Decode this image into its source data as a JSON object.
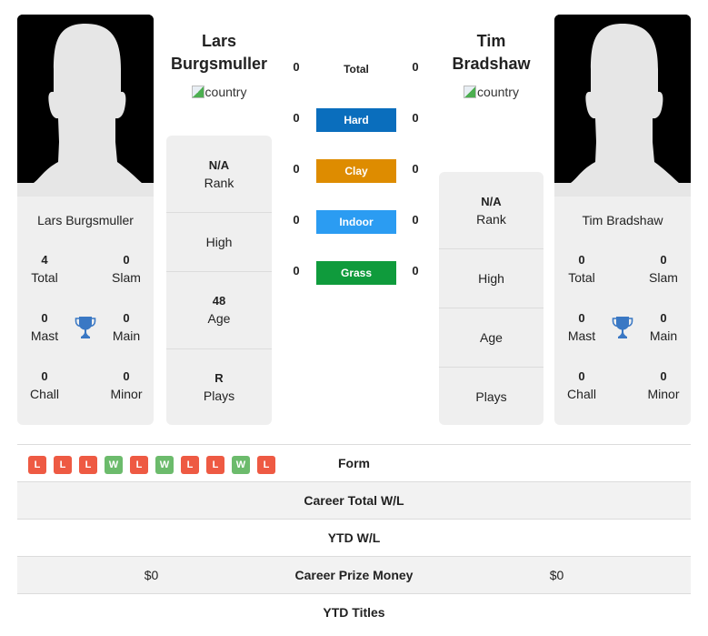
{
  "player1": {
    "name": "Lars Burgsmuller",
    "heading_first": "Lars",
    "heading_last": "Burgsmuller",
    "country_alt": "country",
    "titles": {
      "total": {
        "value": "4",
        "label": "Total"
      },
      "slam": {
        "value": "0",
        "label": "Slam"
      },
      "mast": {
        "value": "0",
        "label": "Mast"
      },
      "main": {
        "value": "0",
        "label": "Main"
      },
      "chall": {
        "value": "0",
        "label": "Chall"
      },
      "minor": {
        "value": "0",
        "label": "Minor"
      }
    },
    "info": {
      "rank": {
        "value": "N/A",
        "label": "Rank"
      },
      "high": {
        "value": "",
        "label": "High"
      },
      "age": {
        "value": "48",
        "label": "Age"
      },
      "plays": {
        "value": "R",
        "label": "Plays"
      }
    },
    "form": [
      "L",
      "L",
      "L",
      "W",
      "L",
      "W",
      "L",
      "L",
      "W",
      "L"
    ],
    "career_prize_money": "$0"
  },
  "player2": {
    "name": "Tim Bradshaw",
    "heading_first": "Tim",
    "heading_last": "Bradshaw",
    "country_alt": "country",
    "titles": {
      "total": {
        "value": "0",
        "label": "Total"
      },
      "slam": {
        "value": "0",
        "label": "Slam"
      },
      "mast": {
        "value": "0",
        "label": "Mast"
      },
      "main": {
        "value": "0",
        "label": "Main"
      },
      "chall": {
        "value": "0",
        "label": "Chall"
      },
      "minor": {
        "value": "0",
        "label": "Minor"
      }
    },
    "info": {
      "rank": {
        "value": "N/A",
        "label": "Rank"
      },
      "high": {
        "value": "",
        "label": "High"
      },
      "age": {
        "value": "",
        "label": "Age"
      },
      "plays": {
        "value": "",
        "label": "Plays"
      }
    },
    "career_prize_money": "$0"
  },
  "h2h": {
    "total": {
      "label": "Total",
      "p1": "0",
      "p2": "0"
    },
    "surfaces": [
      {
        "label": "Hard",
        "p1": "0",
        "p2": "0",
        "color": "#0a6ebd"
      },
      {
        "label": "Clay",
        "p1": "0",
        "p2": "0",
        "color": "#de8c00"
      },
      {
        "label": "Indoor",
        "p1": "0",
        "p2": "0",
        "color": "#2b9cf2"
      },
      {
        "label": "Grass",
        "p1": "0",
        "p2": "0",
        "color": "#0f9b3c"
      }
    ]
  },
  "comparison": {
    "form_label": "Form",
    "career_total_wl_label": "Career Total W/L",
    "ytd_wl_label": "YTD W/L",
    "career_prize_money_label": "Career Prize Money",
    "ytd_titles_label": "YTD Titles"
  },
  "colors": {
    "win": "#6cbb6c",
    "loss": "#ee5a43",
    "trophy": "#3a78c4"
  }
}
